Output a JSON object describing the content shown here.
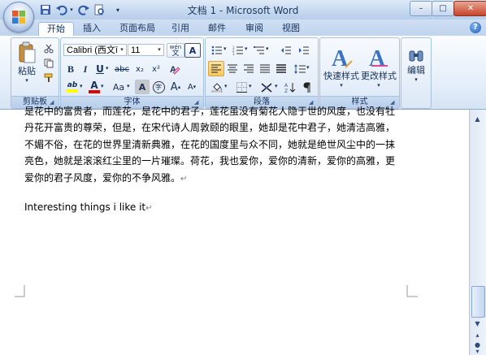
{
  "window": {
    "title": "文档 1 - Microsoft Word",
    "minimize": "–",
    "maximize": "□",
    "close": "✕"
  },
  "tabs": [
    {
      "label": "开始",
      "active": true
    },
    {
      "label": "插入"
    },
    {
      "label": "页面布局"
    },
    {
      "label": "引用"
    },
    {
      "label": "邮件"
    },
    {
      "label": "审阅"
    },
    {
      "label": "视图"
    }
  ],
  "help": "?",
  "ribbon": {
    "clipboard": {
      "label": "剪贴板",
      "paste_label": "粘贴"
    },
    "font": {
      "label": "字体",
      "font_name": "Calibri (西文ī",
      "font_size": "11",
      "phonetic": "wén",
      "bold": "B",
      "italic": "I",
      "underline": "U",
      "strike": "abc",
      "subscript": "x₂",
      "superscript": "x²",
      "highlight": "ab",
      "font_color": "A",
      "change_case": "Aa",
      "char_shading": "A",
      "enclose": "字",
      "grow": "A",
      "shrink": "A",
      "border_char": "A"
    },
    "paragraph": {
      "label": "段落"
    },
    "styles": {
      "label": "样式",
      "quick_styles": "快速样式",
      "change_styles": "更改样式"
    },
    "editing": {
      "label": "编辑"
    }
  },
  "document": {
    "lines": [
      "是花中的富贵者，而莲花，是花中的君子，莲花虽没有菊花人隐于世的风度，也没有牡",
      "丹花开富贵的尊荣，但是，在宋代诗人周敦颐的眼里，她却是花中君子，她清洁高雅，",
      "不媚不俗，在花的世界里清新典雅，在花的国度里与众不同，她就是绝世风尘中的一抹",
      "亮色，她就是滚滚红尘里的一片璀璨。荷花，我也爱你，爱你的清新，爱你的高雅，更",
      "爱你的君子风度，爱你的不争风雅。"
    ],
    "para_mark": "↵",
    "english_line": "Interesting things i like it"
  },
  "colors": {
    "accent": "#15305a",
    "font_color_bar": "#e00000",
    "highlight_bar": "#ffff00"
  }
}
